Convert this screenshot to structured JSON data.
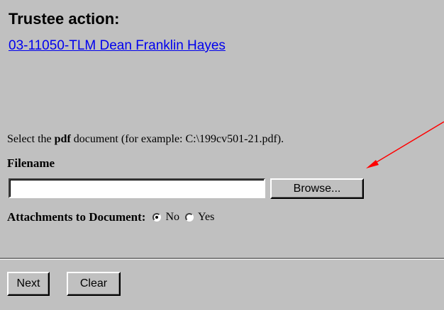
{
  "page": {
    "title": "Trustee action:",
    "case_link": "03-11050-TLM Dean Franklin Hayes"
  },
  "instructions": {
    "prefix": "Select the ",
    "bold": "pdf",
    "suffix": " document (for example: C:\\199cv501-21.pdf)."
  },
  "file": {
    "label": "Filename",
    "value": "",
    "browse_label": "Browse..."
  },
  "attachments": {
    "label": "Attachments to Document:",
    "options": [
      {
        "label": "No",
        "checked": true
      },
      {
        "label": "Yes",
        "checked": false
      }
    ]
  },
  "actions": {
    "next_label": "Next",
    "clear_label": "Clear"
  },
  "colors": {
    "background": "#c0c0c0",
    "link": "#0000ee",
    "annotation_arrow": "#ff0000"
  }
}
